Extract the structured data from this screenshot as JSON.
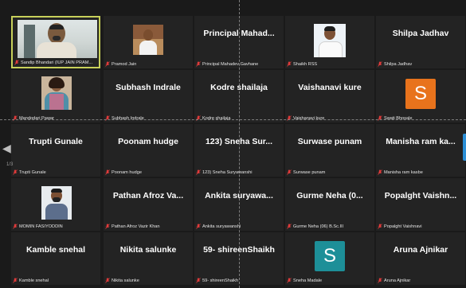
{
  "gallery": {
    "page_indicator": "1/3",
    "prev_arrow": "◀",
    "tiles": [
      {
        "label": "Sandip Bhandari (IUP JAIN PRAM...",
        "center": "",
        "type": "photo"
      },
      {
        "label": "Pramod Jain",
        "center": "",
        "type": "photo"
      },
      {
        "label": "Principal Mahadev Gavhane",
        "center": "Principal  Mahad...",
        "type": "name"
      },
      {
        "label": "Shaikh RSS",
        "center": "",
        "type": "photo"
      },
      {
        "label": "Shilpa Jadhav",
        "center": "Shilpa  Jadhav",
        "type": "name"
      },
      {
        "label": "Mandodari Pawar",
        "center": "",
        "type": "photo"
      },
      {
        "label": "Subhash Indrale",
        "center": "Subhash  Indrale",
        "type": "name"
      },
      {
        "label": "Kodre shailaja",
        "center": "Kodre  shailaja",
        "type": "name"
      },
      {
        "label": "Vaishanavi kure",
        "center": "Vaishanavi  kure",
        "type": "name"
      },
      {
        "label": "Swati Bhosale",
        "center": "",
        "type": "avatar",
        "initial": "S",
        "color": "#e8731c"
      },
      {
        "label": "Trupti Gunale",
        "center": "Trupti  Gunale",
        "type": "name"
      },
      {
        "label": "Poonam hudge",
        "center": "Poonam  hudge",
        "type": "name"
      },
      {
        "label": "123) Sneha Suryawanshi",
        "center": "123)  Sneha  Sur...",
        "type": "name"
      },
      {
        "label": "Surwase punam",
        "center": "Surwase  punam",
        "type": "name"
      },
      {
        "label": "Manisha ram kasbe",
        "center": "Manisha  ram  ka...",
        "type": "name"
      },
      {
        "label": "MOMIN FASIYODDIN",
        "center": "",
        "type": "photo"
      },
      {
        "label": "Pathan Afroz Vazir Khan",
        "center": "Pathan  Afroz  Va...",
        "type": "name"
      },
      {
        "label": "Ankita suryawanshi",
        "center": "Ankita  suryawa...",
        "type": "name"
      },
      {
        "label": "Gurme Neha (06) B.Sc.III",
        "center": "Gurme  Neha  (0...",
        "type": "name"
      },
      {
        "label": "Popalght Vaishnavi",
        "center": "Popalght  Vaishn...",
        "type": "name"
      },
      {
        "label": "Kamble snehal",
        "center": "Kamble  snehal",
        "type": "name"
      },
      {
        "label": "Nikita salunke",
        "center": "Nikita  salunke",
        "type": "name"
      },
      {
        "label": "59- shireenShaikh",
        "center": "59-  shireenShaikh",
        "type": "name"
      },
      {
        "label": "Sneha Madale",
        "center": "",
        "type": "avatar",
        "initial": "S",
        "color": "#1d8f98"
      },
      {
        "label": "Aruna Ajnikar",
        "center": "Aruna  Ajnikar",
        "type": "name"
      }
    ]
  }
}
